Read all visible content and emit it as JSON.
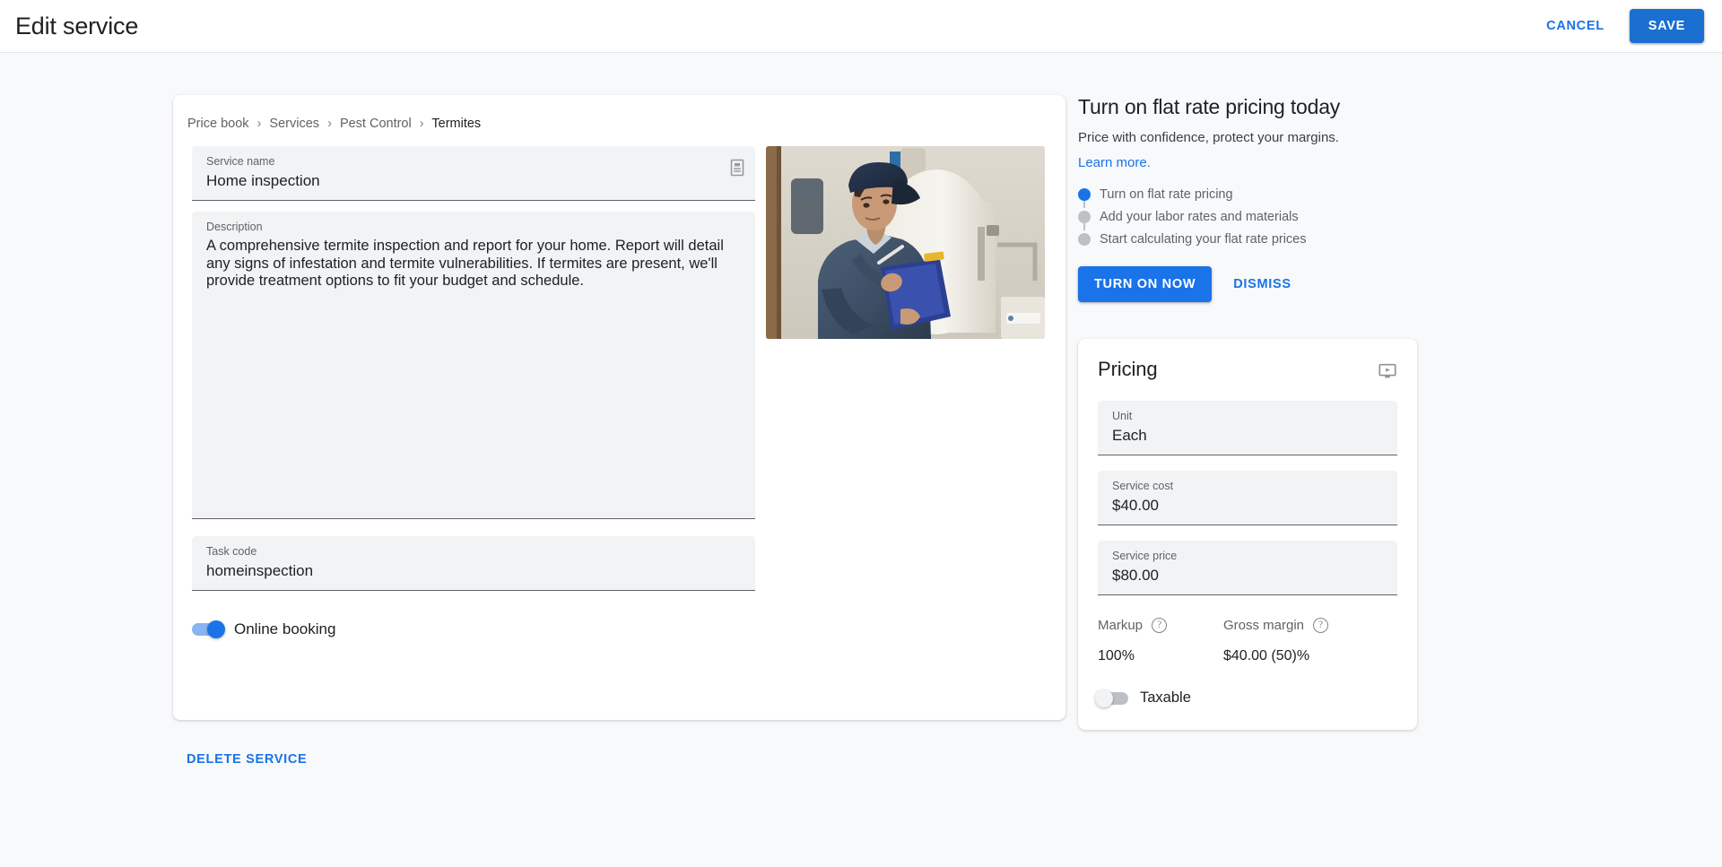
{
  "appbar": {
    "title": "Edit service",
    "cancel_label": "CANCEL",
    "save_label": "SAVE"
  },
  "breadcrumb": {
    "items": [
      "Price book",
      "Services",
      "Pest Control",
      "Termites"
    ],
    "separator": "›"
  },
  "form": {
    "service_name": {
      "label": "Service name",
      "value": "Home inspection"
    },
    "description": {
      "label": "Description",
      "value": "A comprehensive termite inspection and report for your home. Report will detail any signs of infestation and termite vulnerabilities. If termites are present, we'll provide treatment options to fit your budget and schedule."
    },
    "task_code": {
      "label": "Task code",
      "value": "homeinspection"
    },
    "online_booking": {
      "label": "Online booking",
      "state": "on"
    }
  },
  "delete_service_label": "DELETE SERVICE",
  "promo": {
    "title": "Turn on flat rate pricing today",
    "subtitle": "Price with confidence, protect your margins.",
    "link_label": "Learn more.",
    "steps": [
      {
        "label": "Turn on flat rate pricing",
        "state": "active"
      },
      {
        "label": "Add your labor rates and materials",
        "state": "inactive"
      },
      {
        "label": "Start calculating your flat rate prices",
        "state": "inactive"
      }
    ],
    "primary_label": "TURN ON NOW",
    "dismiss_label": "DISMISS"
  },
  "pricing": {
    "title": "Pricing",
    "fields": [
      {
        "label": "Unit",
        "value": "Each"
      },
      {
        "label": "Service cost",
        "value": "$40.00"
      },
      {
        "label": "Service price",
        "value": "$80.00"
      }
    ],
    "metrics": [
      {
        "label": "Markup",
        "value": "100%",
        "help": "?"
      },
      {
        "label": "Gross margin",
        "value": "$40.00 (50)%",
        "help": "?"
      }
    ],
    "taxable": {
      "label": "Taxable",
      "state": "off"
    }
  },
  "colors": {
    "accent": "#1a73e8",
    "accent_button": "#1a6fd0",
    "page_bg": "#f8f9fa",
    "field_bg": "#f1f3f4",
    "muted_text": "#5f6368",
    "toggle_on_track": "#8ab4f0",
    "toggle_off_track": "#bdc1c6"
  }
}
